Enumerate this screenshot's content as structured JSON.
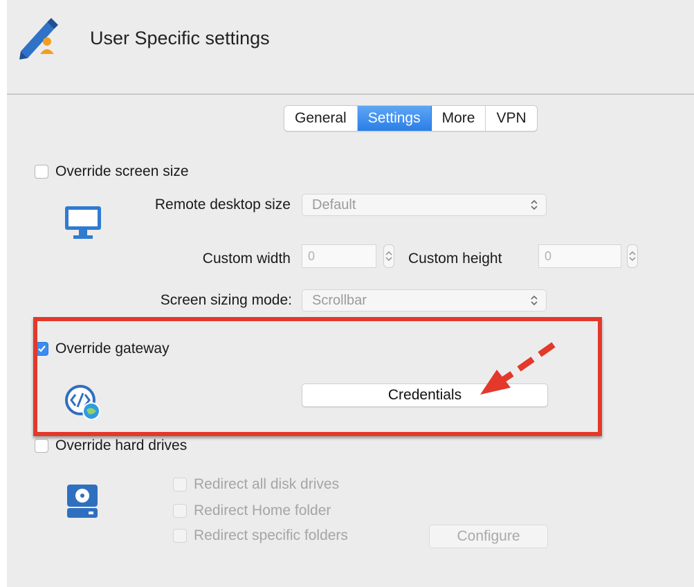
{
  "header": {
    "title": "User Specific settings",
    "icon": "pencil-user-icon"
  },
  "tabs": [
    {
      "label": "General",
      "active": false
    },
    {
      "label": "Settings",
      "active": true
    },
    {
      "label": "More",
      "active": false
    },
    {
      "label": "VPN",
      "active": false
    }
  ],
  "screen": {
    "override_label": "Override screen size",
    "override_checked": false,
    "icon": "monitor-icon",
    "desktop_size_label": "Remote desktop size",
    "desktop_size_value": "Default",
    "custom_width_label": "Custom width",
    "custom_width_value": "0",
    "custom_height_label": "Custom height",
    "custom_height_value": "0",
    "sizing_mode_label": "Screen sizing mode:",
    "sizing_mode_value": "Scrollbar"
  },
  "gateway": {
    "override_label": "Override gateway",
    "override_checked": true,
    "icon": "gateway-globe-icon",
    "credentials_button": "Credentials"
  },
  "drives": {
    "override_label": "Override hard drives",
    "override_checked": false,
    "icon": "hard-drive-icon",
    "options": [
      {
        "label": "Redirect all disk drives",
        "checked": false
      },
      {
        "label": "Redirect Home folder",
        "checked": false
      },
      {
        "label": "Redirect specific folders",
        "checked": false
      }
    ],
    "configure_button": "Configure"
  },
  "colors": {
    "accent": "#3a8cf0",
    "highlight": "#e3382a",
    "window_bg": "#ececec"
  }
}
